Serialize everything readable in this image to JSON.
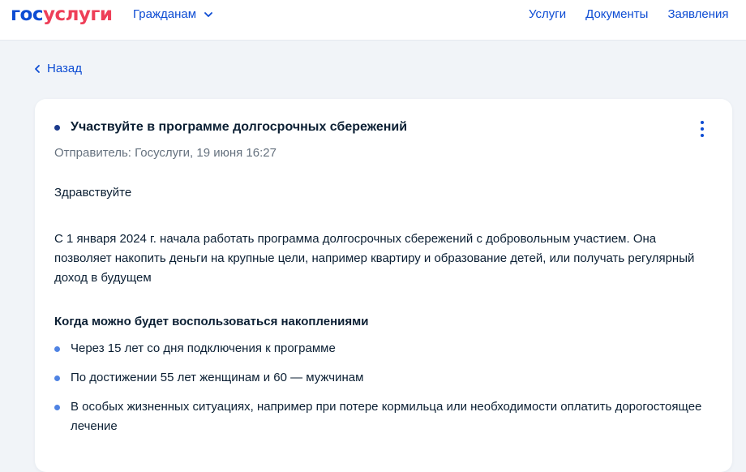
{
  "header": {
    "logo_part1": "гос",
    "logo_part2": "услуги",
    "audience_menu": "Гражданам",
    "links": [
      "Услуги",
      "Документы",
      "Заявления"
    ]
  },
  "back_label": "Назад",
  "message": {
    "title": "Участвуйте в программе долгосрочных сбережений",
    "sender": "Отправитель: Госуслуги, 19 июня 16:27",
    "greeting": "Здравствуйте",
    "paragraph": "С 1 января 2024 г. начала работать программа долгосрочных сбережений с добровольным участием. Она позволяет накопить деньги на крупные цели, например квартиру и образование детей, или получать регулярный доход в будущем",
    "subheading": "Когда можно будет воспользоваться накоплениями",
    "bullets": [
      "Через 15 лет со дня подключения к программе",
      "По достижении 55 лет женщинам и 60 — мужчинам",
      "В особых жизненных ситуациях, например при потере кормильца или необходимости оплатить дорогостоящее лечение"
    ]
  },
  "colors": {
    "brand_blue": "#0d4cd3",
    "brand_red": "#ee3f58",
    "background": "#f1f4f8",
    "muted_text": "#66727f"
  },
  "icons": [
    "chevron-down-icon",
    "chevron-left-icon",
    "more-vertical-icon"
  ]
}
